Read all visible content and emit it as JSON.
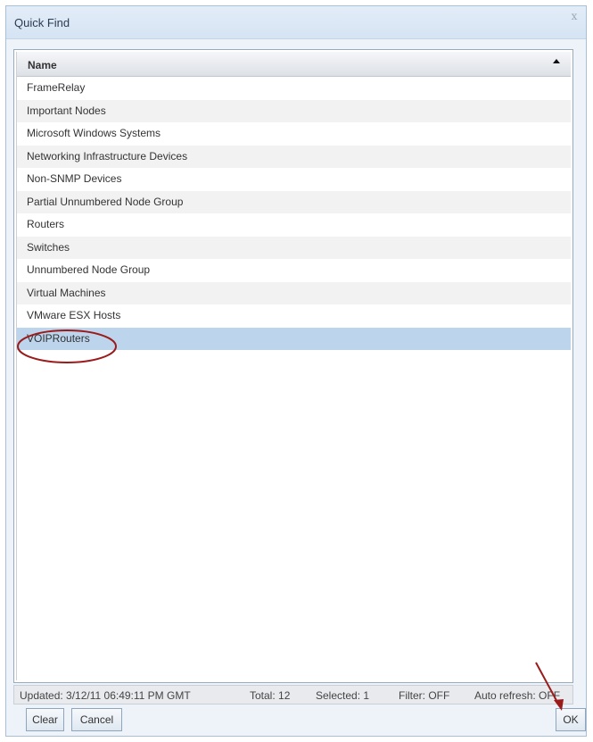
{
  "dialog": {
    "title": "Quick Find",
    "close_glyph": "x"
  },
  "grid": {
    "column_header": "Name",
    "sort_direction": "ascending",
    "rows": [
      "FrameRelay",
      "Important Nodes",
      "Microsoft Windows Systems",
      "Networking Infrastructure Devices",
      "Non-SNMP Devices",
      "Partial Unnumbered Node Group",
      "Routers",
      "Switches",
      "Unnumbered Node Group",
      "Virtual Machines",
      "VMware ESX Hosts",
      "VOIPRouters"
    ],
    "selected_row": "VOIPRouters"
  },
  "status": {
    "updated": "Updated: 3/12/11 06:49:11 PM GMT",
    "total": "Total: 12",
    "selected": "Selected: 1",
    "filter": "Filter: OFF",
    "auto_refresh": "Auto refresh: OFF"
  },
  "buttons": {
    "clear": "Clear",
    "cancel": "Cancel",
    "ok": "OK"
  },
  "colors": {
    "selection": "#bcd4ec",
    "annotation": "#9b1b1b",
    "title_bar": "#dbe7f5"
  }
}
